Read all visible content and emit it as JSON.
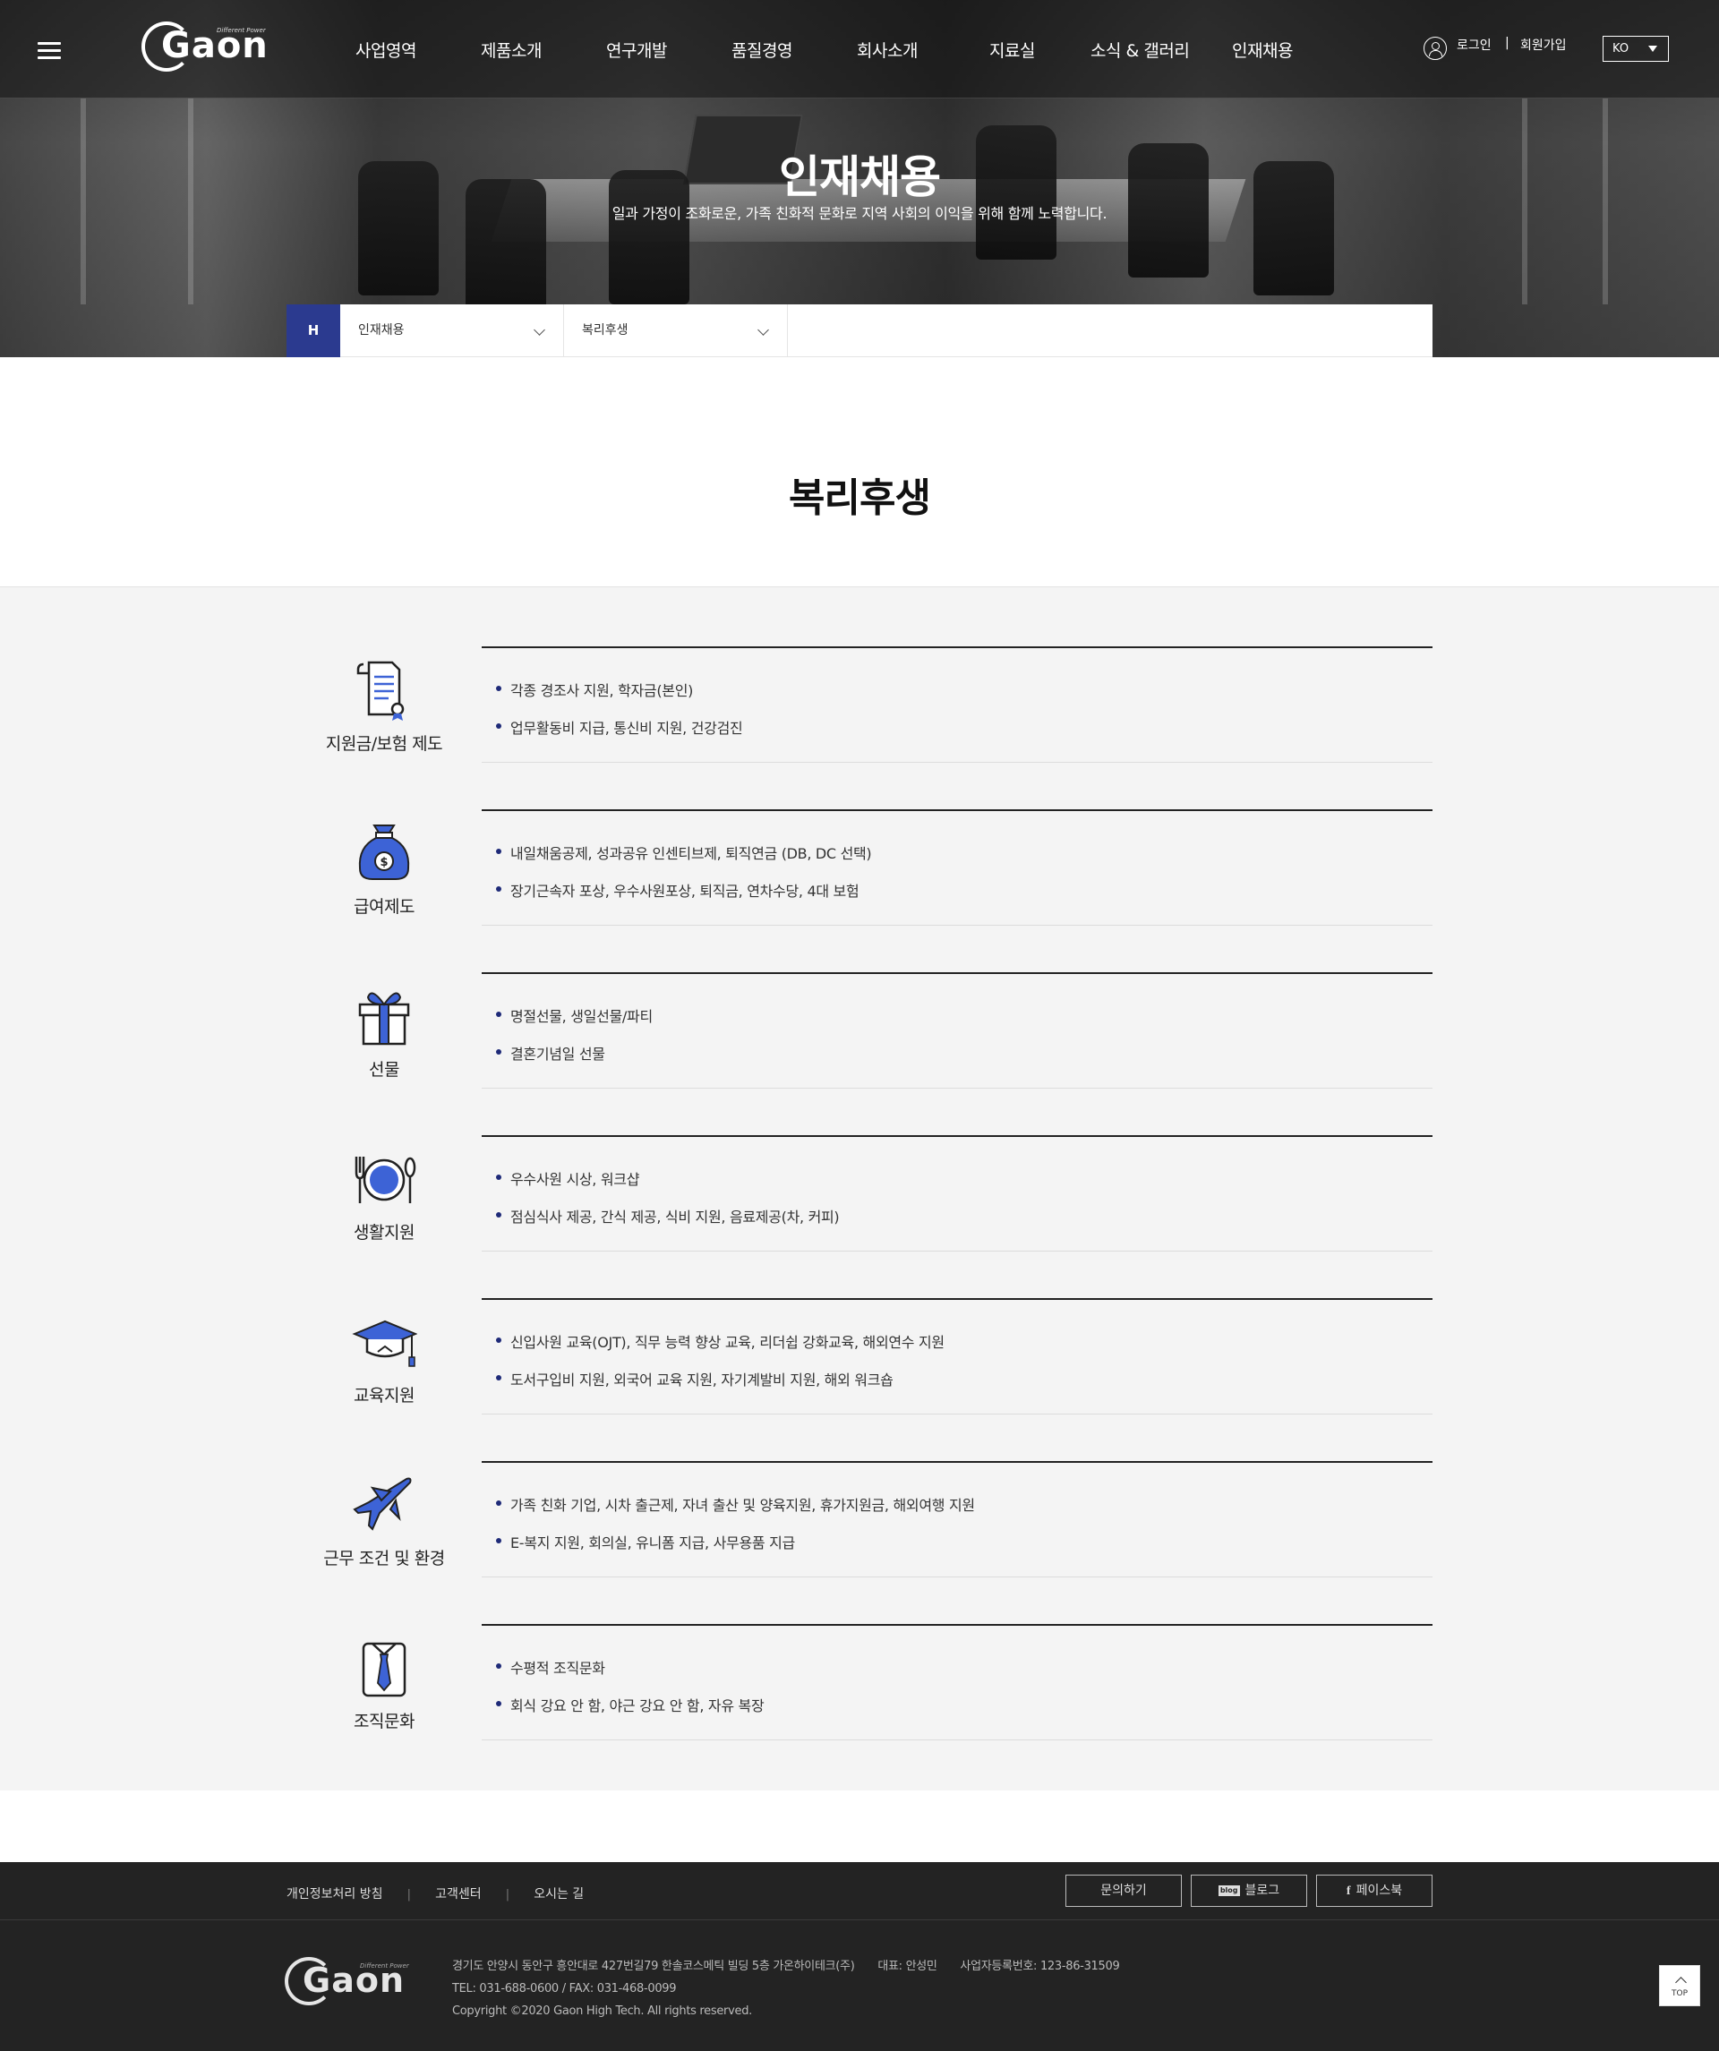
{
  "header": {
    "logo_text": "Gaon",
    "logo_tagline": "Different Power",
    "nav": [
      {
        "label": "사업영역"
      },
      {
        "label": "제품소개"
      },
      {
        "label": "연구개발"
      },
      {
        "label": "품질경영"
      },
      {
        "label": "회사소개"
      },
      {
        "label": "지료실"
      },
      {
        "label": "소식 & 갤러리"
      },
      {
        "label": "인재채용"
      }
    ],
    "login_label": "로그인",
    "separator": "|",
    "signup_label": "회원가입",
    "lang_label": "KO"
  },
  "hero": {
    "title": "인재채용",
    "subtitle": "일과 가정이 조화로운, 가족 친화적 문화로 지역 사회의 이익을 위해 함께 노력합니다."
  },
  "breadcrumb": {
    "home_label": "H",
    "level1": "인재채용",
    "level2": "복리후생"
  },
  "page_title": "복리후생",
  "benefits": [
    {
      "category": "지원금/보험 제도",
      "icon": "document-certificate-icon",
      "items": [
        "각종 경조사 지원, 학자금(본인)",
        "업무활동비 지급, 통신비 지원, 건강검진"
      ]
    },
    {
      "category": "급여제도",
      "icon": "money-bag-icon",
      "items": [
        "내일채움공제, 성과공유 인센티브제, 퇴직연금 (DB, DC 선택)",
        "장기근속자 포상, 우수사원포상, 퇴직금, 연차수당, 4대 보험"
      ]
    },
    {
      "category": "선물",
      "icon": "gift-box-icon",
      "items": [
        "명절선물, 생일선물/파티",
        "결혼기념일 선물"
      ]
    },
    {
      "category": "생활지원",
      "icon": "dining-plate-icon",
      "items": [
        "우수사원 시상, 워크샵",
        "점심식사 제공, 간식 제공, 식비 지원, 음료제공(차, 커피)"
      ]
    },
    {
      "category": "교육지원",
      "icon": "graduation-cap-icon",
      "items": [
        "신입사원 교육(OJT), 직무 능력 향상 교육, 리더쉽 강화교육, 해외연수 지원",
        "도서구입비 지원, 외국어 교육 지원, 자기계발비 지원, 해외 워크숍"
      ]
    },
    {
      "category": "근무 조건 및 환경",
      "icon": "airplane-icon",
      "items": [
        "가족 친화 기업, 시차 출근제, 자녀 출산 및 양육지원, 휴가지원금, 해외여행 지원",
        "E-복지 지원, 회의실, 유니폼 지급, 사무용품 지급"
      ]
    },
    {
      "category": "조직문화",
      "icon": "shirt-tie-icon",
      "items": [
        "수평적 조직문화",
        "회식 강요 안 함, 야근 강요 안 함, 자유 복장"
      ]
    }
  ],
  "footer": {
    "links": [
      "개인정보처리 방침",
      "고객센터",
      "오시는 길"
    ],
    "link_separator": "|",
    "buttons": {
      "inquiry": "문의하기",
      "blog": "블로그",
      "blog_badge": "blog",
      "facebook": "페이스북"
    },
    "address": "경기도 안양시 동안구 흥안대로 427번길79 한솔코스메틱 빌딩 5층 가온하이테크(주)",
    "ceo": "대표: 안성민",
    "biz_no": "사업자등록번호: 123-86-31509",
    "contact": "TEL: 031-688-0600 / FAX: 031-468-0099",
    "copyright": "Copyright ©2020 Gaon High Tech. All rights reserved.",
    "top_label": "TOP"
  },
  "colors": {
    "accent": "#2b3a8f",
    "icon_blue": "#3d63d6",
    "footer_bg": "#232323",
    "section_bg": "#f4f4f4"
  }
}
